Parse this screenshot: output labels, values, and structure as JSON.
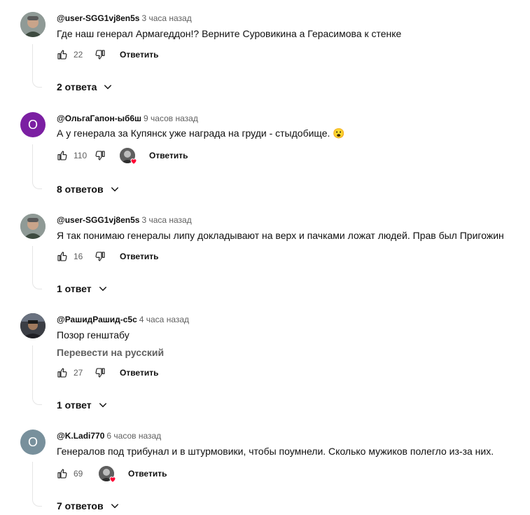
{
  "comments": [
    {
      "author": "@user-SGG1vj8en5s",
      "time": "3 часа назад",
      "text": "Где наш генерал Армагеддон!? Верните Суровикина а Герасимова к стенке",
      "likes": "22",
      "reply_label": "Ответить",
      "replies_label": "2 ответа",
      "avatar_icon": "photo-avatar-man"
    },
    {
      "author": "@ОльгаГапон-ыб6ш",
      "time": "9 часов назад",
      "text": "А у генерала за Купянск уже награда на груди - стыдобище.",
      "emoji": "😮",
      "likes": "110",
      "reply_label": "Ответить",
      "replies_label": "8 ответов",
      "avatar_letter": "О",
      "avatar_color": "#7b1fa2",
      "creator_heart": true
    },
    {
      "author": "@user-SGG1vj8en5s",
      "time": "3 часа назад",
      "text": "Я так понимаю генералы липу докладывают на верх и пачками ложат людей. Прав был Пригожин",
      "likes": "16",
      "reply_label": "Ответить",
      "replies_label": "1 ответ",
      "avatar_icon": "photo-avatar-man"
    },
    {
      "author": "@РашидРашид-с5с",
      "time": "4 часа назад",
      "text": "Позор генштабу",
      "translate_label": "Перевести на русский",
      "likes": "27",
      "reply_label": "Ответить",
      "replies_label": "1 ответ",
      "avatar_icon": "photo-avatar-dark"
    },
    {
      "author": "@K.Ladi770",
      "time": "6 часов назад",
      "text": "Генералов под трибунал и в штурмовики, чтобы поумнели. Сколько мужиков полегло из-за них.",
      "likes": "69",
      "reply_label": "Ответить",
      "replies_label": "7 ответов",
      "avatar_letter": "О",
      "avatar_color": "#78909c",
      "creator_heart": true
    }
  ],
  "colors": {
    "heart": "#ff0033",
    "secondary_text": "#606060"
  }
}
